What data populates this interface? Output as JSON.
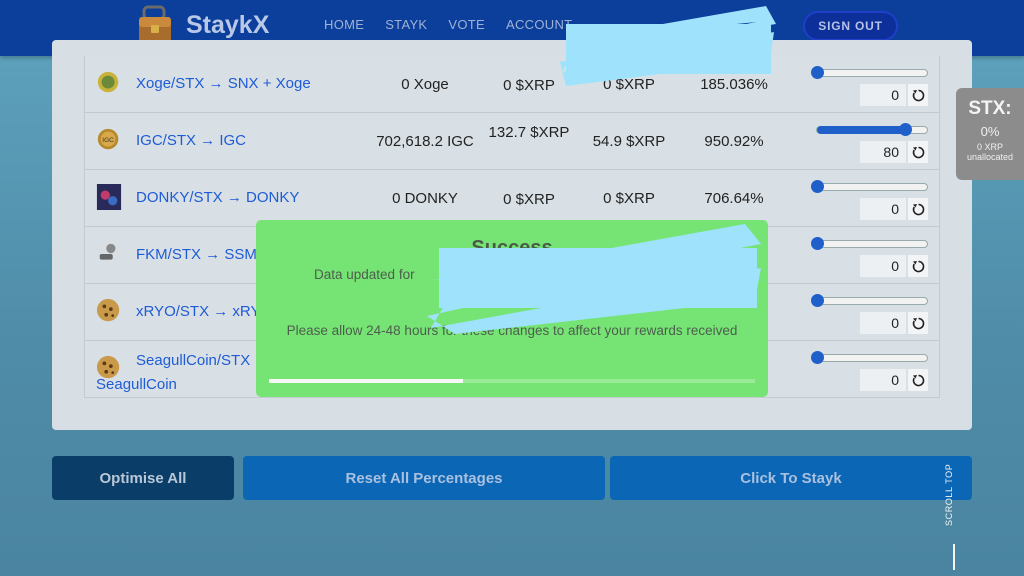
{
  "app": {
    "brand": "StaykX",
    "nav": [
      "HOME",
      "STAYK",
      "VOTE",
      "ACCOUNT"
    ],
    "sign_out": "SIGN OUT"
  },
  "rows": [
    {
      "pair": "Xoge/STX → SNX + Xoge",
      "icon": "xoge-coin-icon",
      "staked": "0 Xoge",
      "col2": "0 $XRP",
      "col3": "0 $XRP",
      "apr": "185.036%",
      "slider_pct": 0,
      "input": "0"
    },
    {
      "pair": "IGC/STX → IGC",
      "icon": "igc-coin-icon",
      "staked": "702,618.2 IGC",
      "col2": "132.7 $XRP",
      "col3": "54.9 $XRP",
      "apr": "950.92%",
      "slider_pct": 80,
      "input": "80"
    },
    {
      "pair": "DONKY/STX → DONKY",
      "icon": "donky-token-icon",
      "staked": "0 DONKY",
      "col2": "0 $XRP",
      "col3": "0 $XRP",
      "apr": "706.64%",
      "slider_pct": 0,
      "input": "0"
    },
    {
      "pair": "FKM/STX → SSM",
      "icon": "fkm-token-icon",
      "staked": "",
      "col2": "",
      "col3": "",
      "apr": "",
      "slider_pct": 0,
      "input": "0"
    },
    {
      "pair": "xRYO/STX → xRYO",
      "icon": "cookie-icon",
      "staked": "",
      "col2": "",
      "col3": "",
      "apr": "",
      "slider_pct": 0,
      "input": "0"
    },
    {
      "pair": "SeagullCoin/STX → SeagullCoin",
      "icon": "cookie-icon",
      "staked": "",
      "col2": "",
      "col3": "",
      "apr": "",
      "slider_pct": 0,
      "input": "0"
    }
  ],
  "stx_panel": {
    "title": "STX:",
    "percent": "0%",
    "xrp": "0 XRP",
    "status": "unallocated"
  },
  "buttons": {
    "optimise": "Optimise All",
    "reset": "Reset All Percentages",
    "stayk": "Click To Stayk"
  },
  "scroll_top": "SCROLL TOP",
  "modal": {
    "title": "Success",
    "line1": "Data updated for",
    "line2": "Please allow 24-48 hours for these changes to affect your rewards received",
    "progress": 0.4
  },
  "colors": {
    "nav_bg": "#0b3f9b",
    "link": "#1e5bd6",
    "modal_bg": "#76e474",
    "button_blue": "#0b67b5",
    "button_dark": "#0a3e69"
  }
}
